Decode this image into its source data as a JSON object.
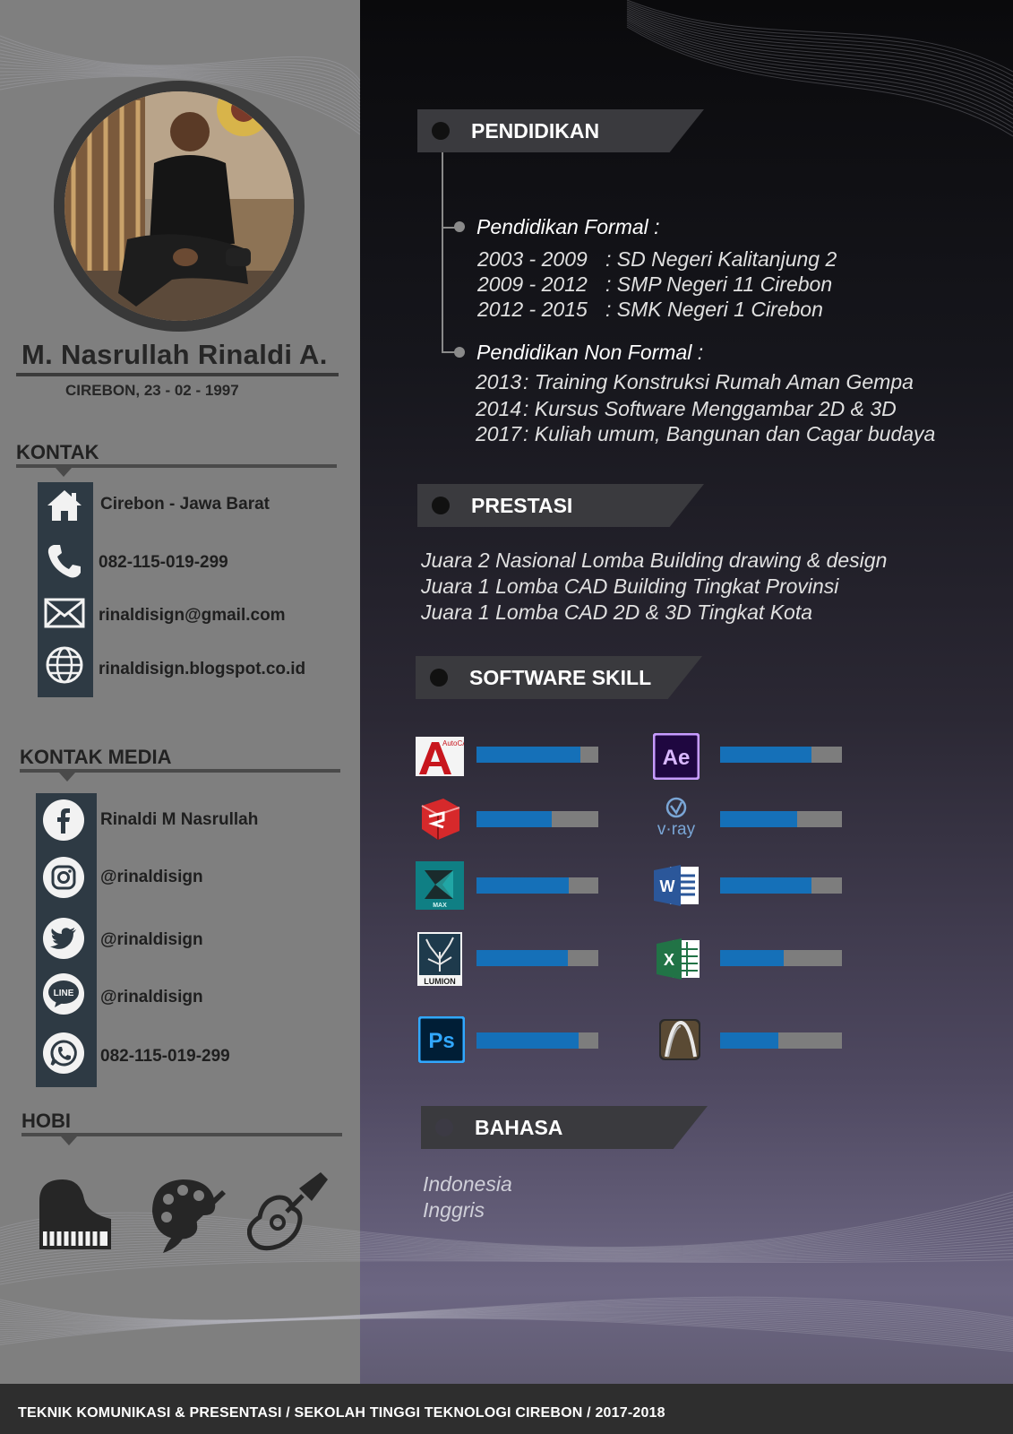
{
  "profile": {
    "name": "M. Nasrullah Rinaldi A.",
    "birth": "CIREBON, 23 - 02 - 1997"
  },
  "kontak": {
    "title": "KONTAK",
    "items": [
      {
        "icon": "home-icon",
        "text": "Cirebon - Jawa Barat"
      },
      {
        "icon": "phone-icon",
        "text": "082-115-019-299"
      },
      {
        "icon": "mail-icon",
        "text": "rinaldisign@gmail.com"
      },
      {
        "icon": "globe-icon",
        "text": "rinaldisign.blogspot.co.id"
      }
    ]
  },
  "kontak_media": {
    "title": "KONTAK MEDIA",
    "items": [
      {
        "icon": "facebook-icon",
        "text": "Rinaldi M Nasrullah"
      },
      {
        "icon": "instagram-icon",
        "text": "@rinaldisign"
      },
      {
        "icon": "twitter-icon",
        "text": "@rinaldisign"
      },
      {
        "icon": "line-icon",
        "text": "@rinaldisign",
        "icon_text": "LINE"
      },
      {
        "icon": "whatsapp-icon",
        "text": "082-115-019-299"
      }
    ]
  },
  "hobi": {
    "title": "HOBI",
    "icons": [
      "piano-icon",
      "paint-palette-icon",
      "guitar-icon"
    ]
  },
  "pendidikan": {
    "title": "PENDIDIKAN",
    "formal_title": "Pendidikan Formal :",
    "formal": [
      {
        "years": "2003 - 2009",
        "school": ": SD Negeri Kalitanjung 2"
      },
      {
        "years": "2009 - 2012",
        "school": ": SMP Negeri 11 Cirebon"
      },
      {
        "years": "2012 - 2015",
        "school": ": SMK Negeri 1 Cirebon"
      }
    ],
    "nonformal_title": "Pendidikan Non Formal :",
    "nonformal": [
      {
        "year": "2013",
        "text": ": Training Konstruksi Rumah Aman Gempa"
      },
      {
        "year": "2014",
        "text": ": Kursus Software Menggambar 2D & 3D"
      },
      {
        "year": "2017",
        "text": ": Kuliah umum, Bangunan dan Cagar budaya"
      }
    ]
  },
  "prestasi": {
    "title": "PRESTASI",
    "items": [
      "Juara 2 Nasional Lomba Building drawing & design",
      "Juara 1 Lomba CAD Building Tingkat Provinsi",
      "Juara 1 Lomba CAD 2D & 3D Tingkat Kota"
    ]
  },
  "software": {
    "title": "SOFTWARE SKILL",
    "left": [
      {
        "icon": "autocad-icon",
        "label": "AutoCAD",
        "level": 0.85
      },
      {
        "icon": "sketchup-icon",
        "level": 0.62
      },
      {
        "icon": "3dsmax-icon",
        "label": "MAX",
        "level": 0.76
      },
      {
        "icon": "lumion-icon",
        "label": "LUMION",
        "level": 0.75
      },
      {
        "icon": "photoshop-icon",
        "label": "Ps",
        "level": 0.84
      }
    ],
    "right": [
      {
        "icon": "after-effects-icon",
        "label": "Ae",
        "level": 0.75
      },
      {
        "icon": "vray-icon",
        "label": "v·ray",
        "level": 0.63
      },
      {
        "icon": "word-icon",
        "label": "W",
        "level": 0.75
      },
      {
        "icon": "excel-icon",
        "label": "X",
        "level": 0.52
      },
      {
        "icon": "archicad-icon",
        "level": 0.48
      }
    ]
  },
  "bahasa": {
    "title": "BAHASA",
    "items": [
      "Indonesia",
      "Inggris"
    ]
  },
  "footer": "TEKNIK KOMUNIKASI & PRESENTASI / SEKOLAH TINGGI  TEKNOLOGI CIREBON / 2017-2018",
  "colors": {
    "skill_fill": "#1570b8",
    "skill_track": "#7d7d7d",
    "sidebar": "#7f7f7f",
    "strip": "#2e3a44"
  }
}
